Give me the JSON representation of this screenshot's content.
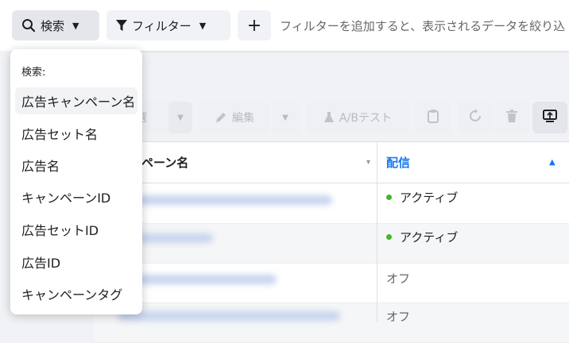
{
  "topbar": {
    "search_label": "検索",
    "filter_label": "フィルター",
    "add_label": "+",
    "hint": "フィルターを追加すると、表示されるデータを絞り込"
  },
  "toolbar": {
    "edit_label": "編集",
    "ab_test_label": "A/Bテスト"
  },
  "table": {
    "headers": {
      "name": "ペーン名",
      "delivery": "配信"
    },
    "rows": [
      {
        "delivery": "アクティブ",
        "status": "active"
      },
      {
        "delivery": "アクティブ",
        "status": "active"
      },
      {
        "delivery": "オフ",
        "status": "off"
      },
      {
        "delivery": "オフ",
        "status": "off"
      }
    ]
  },
  "dropdown": {
    "title": "検索:",
    "items": [
      "広告キャンペーン名",
      "広告セット名",
      "広告名",
      "キャンペーンID",
      "広告セットID",
      "広告ID",
      "キャンペーンタグ"
    ]
  },
  "colors": {
    "accent": "#1877f2",
    "active_dot": "#42b72a"
  }
}
